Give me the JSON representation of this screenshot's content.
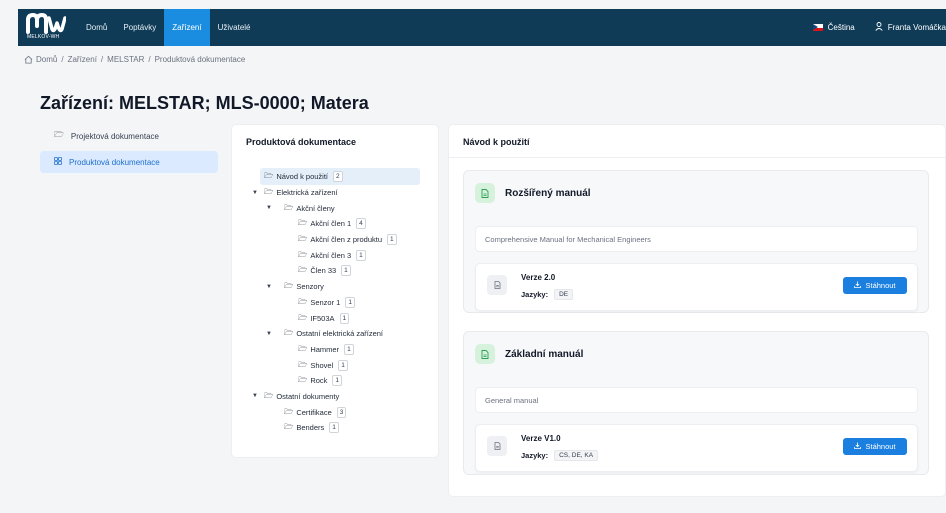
{
  "navbar": {
    "logo_text": "MELKOV-WH",
    "links": [
      {
        "label": "Domů",
        "active": false
      },
      {
        "label": "Poptávky",
        "active": false
      },
      {
        "label": "Zařízení",
        "active": true
      },
      {
        "label": "Uživatelé",
        "active": false
      }
    ],
    "language": "Čeština",
    "user": "Franta Vomáčka",
    "accent_color": "#1b8de0",
    "bar_color": "#0f3b57"
  },
  "breadcrumb": [
    "Domů",
    "Zařízení",
    "MELSTAR",
    "Produktová dokumentace"
  ],
  "page_title": "Zařízení: MELSTAR; MLS-0000; Matera",
  "sidebar": {
    "items": [
      {
        "label": "Projektová dokumentace",
        "icon": "folder-icon",
        "active": false
      },
      {
        "label": "Produktová dokumentace",
        "icon": "grid-icon",
        "active": true
      }
    ]
  },
  "tree_panel": {
    "title": "Produktová dokumentace",
    "nodes": [
      {
        "label": "Návod k použití",
        "count": "2",
        "depth": 0,
        "expandable": false,
        "selected": true
      },
      {
        "label": "Elektrická zařízení",
        "count": "",
        "depth": 0,
        "expandable": true,
        "selected": false
      },
      {
        "label": "Akční členy",
        "count": "",
        "depth": 1,
        "expandable": true,
        "selected": false
      },
      {
        "label": "Akční člen 1",
        "count": "4",
        "depth": 2,
        "expandable": false,
        "selected": false
      },
      {
        "label": "Akční člen z produktu",
        "count": "1",
        "depth": 2,
        "expandable": false,
        "selected": false
      },
      {
        "label": "Akční člen 3",
        "count": "1",
        "depth": 2,
        "expandable": false,
        "selected": false
      },
      {
        "label": "Člen 33",
        "count": "1",
        "depth": 2,
        "expandable": false,
        "selected": false
      },
      {
        "label": "Senzory",
        "count": "",
        "depth": 1,
        "expandable": true,
        "selected": false
      },
      {
        "label": "Senzor 1",
        "count": "1",
        "depth": 2,
        "expandable": false,
        "selected": false
      },
      {
        "label": "IF503A",
        "count": "1",
        "depth": 2,
        "expandable": false,
        "selected": false
      },
      {
        "label": "Ostatní elektrická zařízení",
        "count": "",
        "depth": 1,
        "expandable": true,
        "selected": false
      },
      {
        "label": "Hammer",
        "count": "1",
        "depth": 2,
        "expandable": false,
        "selected": false
      },
      {
        "label": "Shovel",
        "count": "1",
        "depth": 2,
        "expandable": false,
        "selected": false
      },
      {
        "label": "Rock",
        "count": "1",
        "depth": 2,
        "expandable": false,
        "selected": false
      },
      {
        "label": "Ostatní dokumenty",
        "count": "",
        "depth": 0,
        "expandable": true,
        "selected": false
      },
      {
        "label": "Certifikace",
        "count": "3",
        "depth": 1,
        "expandable": false,
        "selected": false
      },
      {
        "label": "Benders",
        "count": "1",
        "depth": 1,
        "expandable": false,
        "selected": false
      }
    ]
  },
  "detail_panel": {
    "title": "Návod k použití",
    "manuals": [
      {
        "title": "Rozšířený manuál",
        "description": "Comprehensive Manual for Mechanical Engineers",
        "version": "Verze 2.0",
        "languages_label": "Jazyky:",
        "languages": "DE",
        "download_label": "Stáhnout"
      },
      {
        "title": "Základní manuál",
        "description": "General manual",
        "version": "Verze V1.0",
        "languages_label": "Jazyky:",
        "languages": "CS, DE, KA",
        "download_label": "Stáhnout"
      }
    ]
  }
}
